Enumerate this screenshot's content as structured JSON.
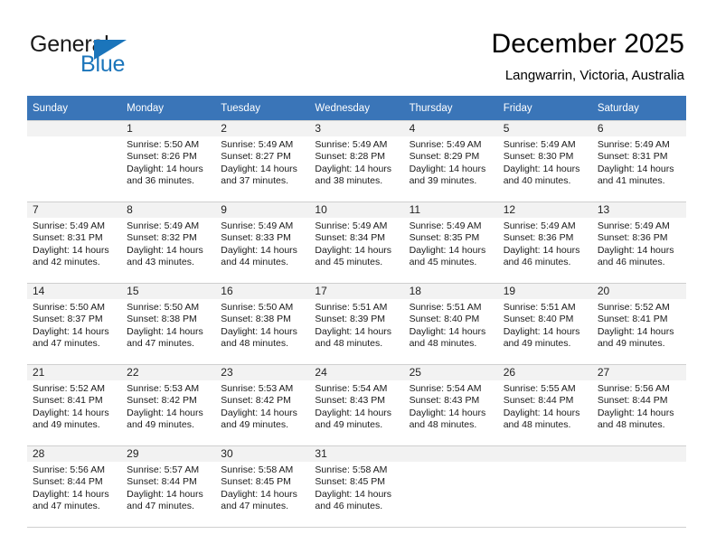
{
  "brand": {
    "name_part1": "General",
    "name_part2": "Blue",
    "logo_color": "#1b75bb"
  },
  "header": {
    "title": "December 2025",
    "subtitle": "Langwarrin, Victoria, Australia"
  },
  "calendar": {
    "header_bg": "#3a75b8",
    "daynum_bg": "#f2f2f2",
    "weekday_headers": [
      "Sunday",
      "Monday",
      "Tuesday",
      "Wednesday",
      "Thursday",
      "Friday",
      "Saturday"
    ],
    "labels": {
      "sunrise": "Sunrise:",
      "sunset": "Sunset:",
      "daylight": "Daylight:"
    },
    "weeks": [
      [
        {
          "day": "",
          "sunrise": "",
          "sunset": "",
          "daylight_line1": "",
          "daylight_line2": ""
        },
        {
          "day": "1",
          "sunrise": "Sunrise: 5:50 AM",
          "sunset": "Sunset: 8:26 PM",
          "daylight_line1": "Daylight: 14 hours",
          "daylight_line2": "and 36 minutes."
        },
        {
          "day": "2",
          "sunrise": "Sunrise: 5:49 AM",
          "sunset": "Sunset: 8:27 PM",
          "daylight_line1": "Daylight: 14 hours",
          "daylight_line2": "and 37 minutes."
        },
        {
          "day": "3",
          "sunrise": "Sunrise: 5:49 AM",
          "sunset": "Sunset: 8:28 PM",
          "daylight_line1": "Daylight: 14 hours",
          "daylight_line2": "and 38 minutes."
        },
        {
          "day": "4",
          "sunrise": "Sunrise: 5:49 AM",
          "sunset": "Sunset: 8:29 PM",
          "daylight_line1": "Daylight: 14 hours",
          "daylight_line2": "and 39 minutes."
        },
        {
          "day": "5",
          "sunrise": "Sunrise: 5:49 AM",
          "sunset": "Sunset: 8:30 PM",
          "daylight_line1": "Daylight: 14 hours",
          "daylight_line2": "and 40 minutes."
        },
        {
          "day": "6",
          "sunrise": "Sunrise: 5:49 AM",
          "sunset": "Sunset: 8:31 PM",
          "daylight_line1": "Daylight: 14 hours",
          "daylight_line2": "and 41 minutes."
        }
      ],
      [
        {
          "day": "7",
          "sunrise": "Sunrise: 5:49 AM",
          "sunset": "Sunset: 8:31 PM",
          "daylight_line1": "Daylight: 14 hours",
          "daylight_line2": "and 42 minutes."
        },
        {
          "day": "8",
          "sunrise": "Sunrise: 5:49 AM",
          "sunset": "Sunset: 8:32 PM",
          "daylight_line1": "Daylight: 14 hours",
          "daylight_line2": "and 43 minutes."
        },
        {
          "day": "9",
          "sunrise": "Sunrise: 5:49 AM",
          "sunset": "Sunset: 8:33 PM",
          "daylight_line1": "Daylight: 14 hours",
          "daylight_line2": "and 44 minutes."
        },
        {
          "day": "10",
          "sunrise": "Sunrise: 5:49 AM",
          "sunset": "Sunset: 8:34 PM",
          "daylight_line1": "Daylight: 14 hours",
          "daylight_line2": "and 45 minutes."
        },
        {
          "day": "11",
          "sunrise": "Sunrise: 5:49 AM",
          "sunset": "Sunset: 8:35 PM",
          "daylight_line1": "Daylight: 14 hours",
          "daylight_line2": "and 45 minutes."
        },
        {
          "day": "12",
          "sunrise": "Sunrise: 5:49 AM",
          "sunset": "Sunset: 8:36 PM",
          "daylight_line1": "Daylight: 14 hours",
          "daylight_line2": "and 46 minutes."
        },
        {
          "day": "13",
          "sunrise": "Sunrise: 5:49 AM",
          "sunset": "Sunset: 8:36 PM",
          "daylight_line1": "Daylight: 14 hours",
          "daylight_line2": "and 46 minutes."
        }
      ],
      [
        {
          "day": "14",
          "sunrise": "Sunrise: 5:50 AM",
          "sunset": "Sunset: 8:37 PM",
          "daylight_line1": "Daylight: 14 hours",
          "daylight_line2": "and 47 minutes."
        },
        {
          "day": "15",
          "sunrise": "Sunrise: 5:50 AM",
          "sunset": "Sunset: 8:38 PM",
          "daylight_line1": "Daylight: 14 hours",
          "daylight_line2": "and 47 minutes."
        },
        {
          "day": "16",
          "sunrise": "Sunrise: 5:50 AM",
          "sunset": "Sunset: 8:38 PM",
          "daylight_line1": "Daylight: 14 hours",
          "daylight_line2": "and 48 minutes."
        },
        {
          "day": "17",
          "sunrise": "Sunrise: 5:51 AM",
          "sunset": "Sunset: 8:39 PM",
          "daylight_line1": "Daylight: 14 hours",
          "daylight_line2": "and 48 minutes."
        },
        {
          "day": "18",
          "sunrise": "Sunrise: 5:51 AM",
          "sunset": "Sunset: 8:40 PM",
          "daylight_line1": "Daylight: 14 hours",
          "daylight_line2": "and 48 minutes."
        },
        {
          "day": "19",
          "sunrise": "Sunrise: 5:51 AM",
          "sunset": "Sunset: 8:40 PM",
          "daylight_line1": "Daylight: 14 hours",
          "daylight_line2": "and 49 minutes."
        },
        {
          "day": "20",
          "sunrise": "Sunrise: 5:52 AM",
          "sunset": "Sunset: 8:41 PM",
          "daylight_line1": "Daylight: 14 hours",
          "daylight_line2": "and 49 minutes."
        }
      ],
      [
        {
          "day": "21",
          "sunrise": "Sunrise: 5:52 AM",
          "sunset": "Sunset: 8:41 PM",
          "daylight_line1": "Daylight: 14 hours",
          "daylight_line2": "and 49 minutes."
        },
        {
          "day": "22",
          "sunrise": "Sunrise: 5:53 AM",
          "sunset": "Sunset: 8:42 PM",
          "daylight_line1": "Daylight: 14 hours",
          "daylight_line2": "and 49 minutes."
        },
        {
          "day": "23",
          "sunrise": "Sunrise: 5:53 AM",
          "sunset": "Sunset: 8:42 PM",
          "daylight_line1": "Daylight: 14 hours",
          "daylight_line2": "and 49 minutes."
        },
        {
          "day": "24",
          "sunrise": "Sunrise: 5:54 AM",
          "sunset": "Sunset: 8:43 PM",
          "daylight_line1": "Daylight: 14 hours",
          "daylight_line2": "and 49 minutes."
        },
        {
          "day": "25",
          "sunrise": "Sunrise: 5:54 AM",
          "sunset": "Sunset: 8:43 PM",
          "daylight_line1": "Daylight: 14 hours",
          "daylight_line2": "and 48 minutes."
        },
        {
          "day": "26",
          "sunrise": "Sunrise: 5:55 AM",
          "sunset": "Sunset: 8:44 PM",
          "daylight_line1": "Daylight: 14 hours",
          "daylight_line2": "and 48 minutes."
        },
        {
          "day": "27",
          "sunrise": "Sunrise: 5:56 AM",
          "sunset": "Sunset: 8:44 PM",
          "daylight_line1": "Daylight: 14 hours",
          "daylight_line2": "and 48 minutes."
        }
      ],
      [
        {
          "day": "28",
          "sunrise": "Sunrise: 5:56 AM",
          "sunset": "Sunset: 8:44 PM",
          "daylight_line1": "Daylight: 14 hours",
          "daylight_line2": "and 47 minutes."
        },
        {
          "day": "29",
          "sunrise": "Sunrise: 5:57 AM",
          "sunset": "Sunset: 8:44 PM",
          "daylight_line1": "Daylight: 14 hours",
          "daylight_line2": "and 47 minutes."
        },
        {
          "day": "30",
          "sunrise": "Sunrise: 5:58 AM",
          "sunset": "Sunset: 8:45 PM",
          "daylight_line1": "Daylight: 14 hours",
          "daylight_line2": "and 47 minutes."
        },
        {
          "day": "31",
          "sunrise": "Sunrise: 5:58 AM",
          "sunset": "Sunset: 8:45 PM",
          "daylight_line1": "Daylight: 14 hours",
          "daylight_line2": "and 46 minutes."
        },
        {
          "day": "",
          "sunrise": "",
          "sunset": "",
          "daylight_line1": "",
          "daylight_line2": ""
        },
        {
          "day": "",
          "sunrise": "",
          "sunset": "",
          "daylight_line1": "",
          "daylight_line2": ""
        },
        {
          "day": "",
          "sunrise": "",
          "sunset": "",
          "daylight_line1": "",
          "daylight_line2": ""
        }
      ]
    ]
  }
}
